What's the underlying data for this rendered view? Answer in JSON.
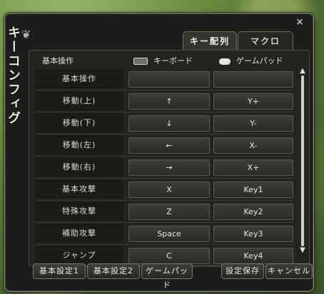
{
  "window": {
    "title": "キーコンフィグ",
    "close_label": "×"
  },
  "tabs": [
    {
      "label": "キー配列",
      "active": true
    },
    {
      "label": "マクロ",
      "active": false
    }
  ],
  "header": {
    "action_label": "基本操作",
    "keyboard_label": "キーボード",
    "gamepad_label": "ゲームパッド"
  },
  "rows": [
    {
      "action": "基本操作",
      "keyboard": "",
      "gamepad": ""
    },
    {
      "action": "移動(上)",
      "keyboard": "↑",
      "gamepad": "Y+"
    },
    {
      "action": "移動(下)",
      "keyboard": "↓",
      "gamepad": "Y-"
    },
    {
      "action": "移動(左)",
      "keyboard": "←",
      "gamepad": "X-"
    },
    {
      "action": "移動(右)",
      "keyboard": "→",
      "gamepad": "X+"
    },
    {
      "action": "基本攻撃",
      "keyboard": "X",
      "gamepad": "Key1"
    },
    {
      "action": "特殊攻撃",
      "keyboard": "Z",
      "gamepad": "Key2"
    },
    {
      "action": "補助攻撃",
      "keyboard": "Space",
      "gamepad": "Key3"
    },
    {
      "action": "ジャンプ",
      "keyboard": "C",
      "gamepad": "Key4"
    }
  ],
  "scroll": {
    "up": "▲",
    "down": "▼"
  },
  "buttons": {
    "preset1": "基本設定1",
    "preset2": "基本設定2",
    "gamepad": "ゲームパッド",
    "save": "設定保存",
    "cancel": "キャンセル"
  },
  "icons": {
    "keyboard": "keyboard-icon",
    "gamepad": "gamepad-icon",
    "ornament": "corner-ornament-icon"
  }
}
